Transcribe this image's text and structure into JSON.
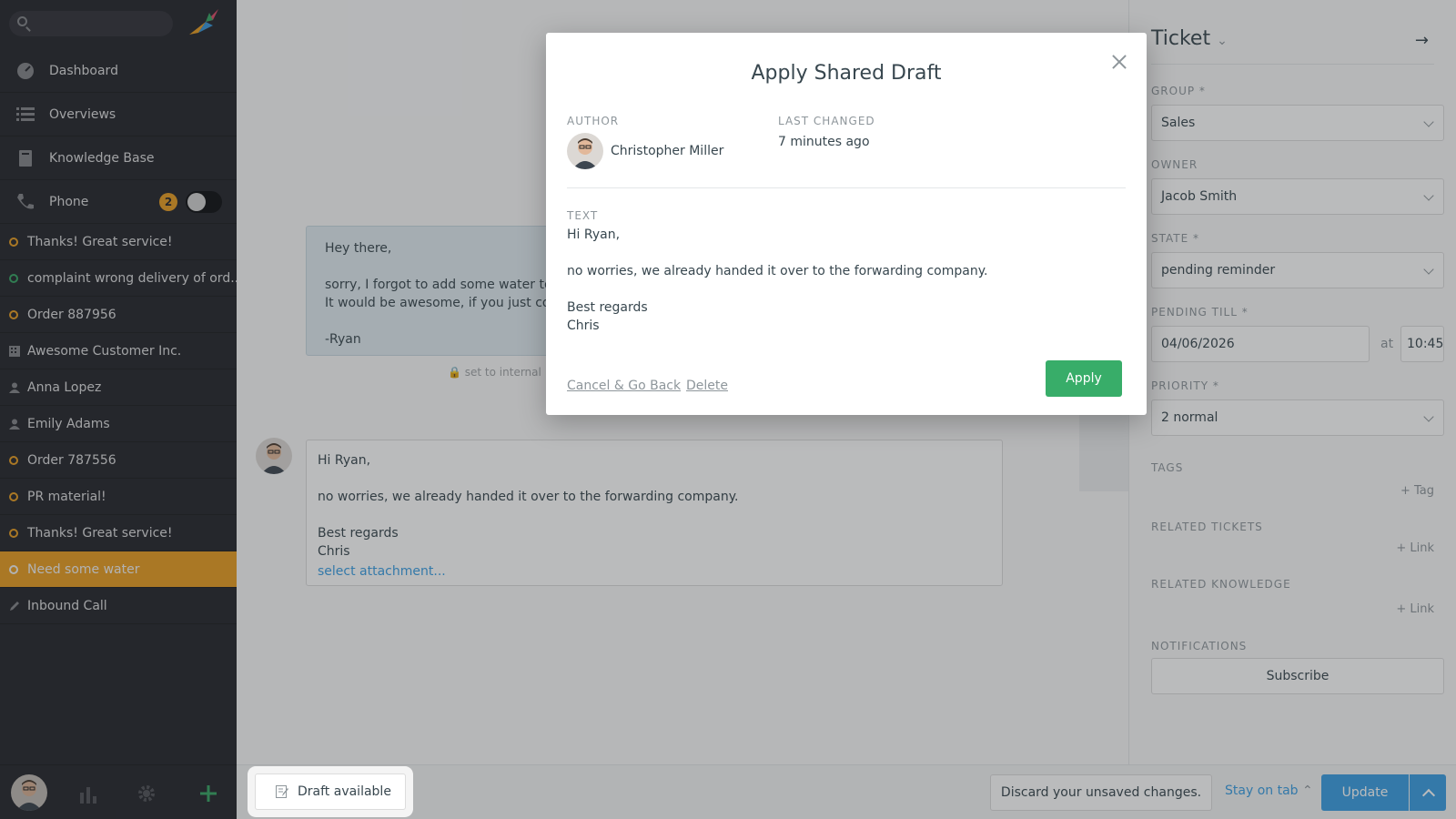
{
  "sidebar": {
    "search": {
      "placeholder": ""
    },
    "nav": [
      {
        "label": "Dashboard",
        "icon": "dashboard-icon"
      },
      {
        "label": "Overviews",
        "icon": "list-icon"
      },
      {
        "label": "Knowledge Base",
        "icon": "book-icon"
      },
      {
        "label": "Phone",
        "icon": "phone-icon",
        "badge": "2"
      }
    ],
    "tasks": [
      {
        "label": "Thanks! Great service!",
        "icon": "ticket-open-icon"
      },
      {
        "label": "complaint wrong delivery of ord...",
        "icon": "ticket-new-icon"
      },
      {
        "label": "Order 887956",
        "icon": "ticket-open-icon"
      },
      {
        "label": "Awesome Customer Inc.",
        "icon": "organization-icon"
      },
      {
        "label": "Anna Lopez",
        "icon": "user-icon"
      },
      {
        "label": "Emily Adams",
        "icon": "user-icon"
      },
      {
        "label": "Order 787556",
        "icon": "ticket-open-icon"
      },
      {
        "label": "PR material!",
        "icon": "ticket-open-icon"
      },
      {
        "label": "Thanks! Great service!",
        "icon": "ticket-open-icon"
      },
      {
        "label": "Need some water",
        "icon": "ticket-open-icon",
        "active": true
      },
      {
        "label": "Inbound Call",
        "icon": "pen-icon"
      }
    ]
  },
  "main": {
    "customer_message": "Hey there,\n\nsorry, I forgot to add some water to my\nIt would be awesome, if you just could\n\n-Ryan",
    "internal_label": "set to internal",
    "reply_text": "Hi Ryan,\n\nno worries, we already handed it over to the forwarding company.\n\nBest regards\nChris",
    "attachment_link": "select attachment..."
  },
  "ticket_panel": {
    "title": "Ticket",
    "group": {
      "label": "GROUP *",
      "value": "Sales"
    },
    "owner": {
      "label": "OWNER",
      "value": "Jacob Smith"
    },
    "state": {
      "label": "STATE *",
      "value": "pending reminder"
    },
    "pending_till": {
      "label": "PENDING TILL *",
      "date": "04/06/2026",
      "at": "at",
      "time": "10:45"
    },
    "priority": {
      "label": "PRIORITY *",
      "value": "2 normal"
    },
    "tags": {
      "label": "TAGS",
      "action": "+ Tag"
    },
    "related_tickets": {
      "label": "RELATED TICKETS",
      "action": "+ Link"
    },
    "related_knowledge": {
      "label": "RELATED KNOWLEDGE",
      "action": "+ Link"
    },
    "notifications": {
      "label": "NOTIFICATIONS",
      "action": "Subscribe"
    }
  },
  "bottom_bar": {
    "draft_label": "Draft available",
    "discard_label": "Discard your unsaved changes.",
    "stay_label": "Stay on tab",
    "update_label": "Update"
  },
  "modal": {
    "title": "Apply Shared Draft",
    "author_label": "AUTHOR",
    "author_name": "Christopher Miller",
    "changed_label": "LAST CHANGED",
    "changed_value": "7 minutes ago",
    "text_label": "TEXT",
    "text": "Hi Ryan,\n\nno worries, we already handed it over to the forwarding company.\n\nBest regards\nChris",
    "cancel_label": "Cancel & Go Back",
    "delete_label": "Delete",
    "apply_label": "Apply"
  },
  "colors": {
    "accent": "#f5a623",
    "primary": "#3a9ee3",
    "success": "#38ad69",
    "sidebar": "#26272e"
  }
}
